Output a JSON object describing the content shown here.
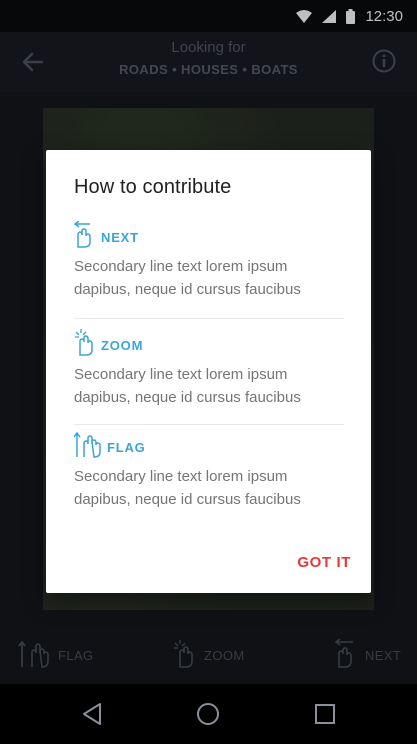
{
  "status_bar": {
    "time": "12:30"
  },
  "app_bar": {
    "title": "Looking for",
    "subtitle": "ROADS • HOUSES • BOATS"
  },
  "bottom_actions": [
    {
      "label": "FLAG"
    },
    {
      "label": "ZOOM"
    },
    {
      "label": "NEXT"
    }
  ],
  "dialog": {
    "title": "How to contribute",
    "sections": [
      {
        "label": "NEXT",
        "icon": "swipe-left-hand-icon",
        "text": "Secondary line text lorem ipsum dapibus, neque id cursus faucibus"
      },
      {
        "label": "ZOOM",
        "icon": "pinch-hand-icon",
        "text": "Secondary line text lorem ipsum dapibus, neque id cursus faucibus"
      },
      {
        "label": "FLAG",
        "icon": "swipe-vertical-hand-icon",
        "text": "Secondary line text lorem ipsum dapibus, neque id cursus faucibus"
      }
    ],
    "action_label": "GOT IT"
  },
  "colors": {
    "accent_blue": "#3ba5d4",
    "action_red": "#e53935",
    "background": "#14171d"
  }
}
